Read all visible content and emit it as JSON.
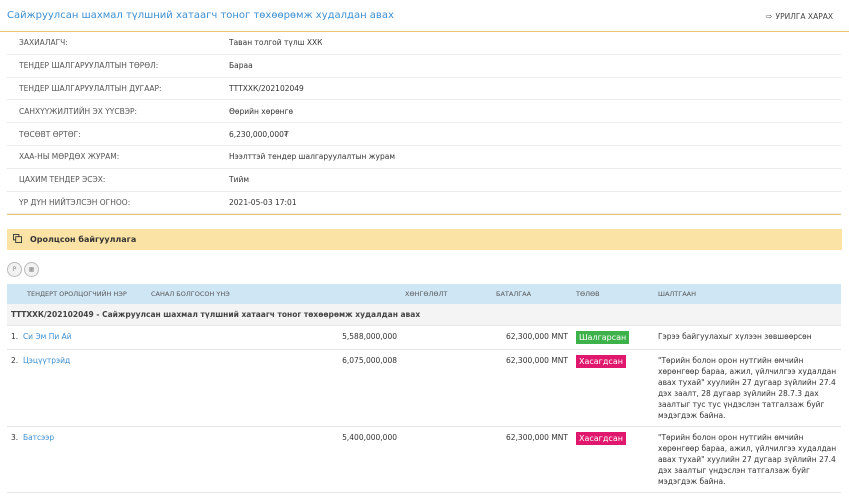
{
  "header": {
    "title": "Сайжруулсан шахмал түлшний хатаагч тоног төхөөрөмж худалдан авах",
    "back_label": "УРИЛГА ХАРАХ"
  },
  "info": [
    {
      "label": "ЗАХИАЛАГЧ:",
      "value": "Таван толгой түлш ХХК"
    },
    {
      "label": "ТЕНДЕР ШАЛГАРУУЛАЛТЫН ТӨРӨЛ:",
      "value": "Бараа"
    },
    {
      "label": "ТЕНДЕР ШАЛГАРУУЛАЛТЫН ДУГААР:",
      "value": "ТТТХХК/202102049"
    },
    {
      "label": "САНХҮҮЖИЛТИЙН ЭХ ҮҮСВЭР:",
      "value": "Өөрийн хөрөнгө"
    },
    {
      "label": "ТӨСӨВТ ӨРТӨГ:",
      "value": "6,230,000,000₮"
    },
    {
      "label": "ХАА-НЫ МӨРДӨХ ЖУРАМ:",
      "value": "Нээлттэй тендер шалгаруулалтын журам"
    },
    {
      "label": "ЦАХИМ ТЕНДЕР ЭСЭХ:",
      "value": "Тийм"
    },
    {
      "label": "ҮР ДҮН НИЙТЭЛСЭН ОГНОО:",
      "value": "2021-05-03 17:01"
    }
  ],
  "section": {
    "title": "Оролцсон байгууллага"
  },
  "toolbar": {
    "btn1": "P",
    "btn2": "▦"
  },
  "table": {
    "headers": [
      "ТЕНДЕРТ ОРОЛЦОГЧИЙН НЭР",
      "САНАЛ БОЛГОСОН ҮНЭ",
      "ХӨНГӨЛӨЛТ",
      "БАТАЛГАА",
      "ТӨЛӨВ",
      "ШАЛТГААН"
    ],
    "group": "ТТТХХК/202102049 - Сайжруулсан шахмал түлшний хатаагч тоног төхөөрөмж худалдан авах",
    "rows": [
      {
        "num": "1.",
        "name": "Си Эм Пи Ай",
        "price": "5,588,000,000",
        "discount": "",
        "guarantee": "62,300,000 MNT",
        "status": "Шалгарсан",
        "reason": "Гэрээ байгуулахыг хүлээн зөвшөөрсөн"
      },
      {
        "num": "2.",
        "name": "Цэцүүтрэйд",
        "price": "6,075,000,008",
        "discount": "",
        "guarantee": "62,300,000 MNT",
        "status": "Хасагдсан",
        "reason": "\"Төрийн болон орон нутгийн өмчийн хөрөнгөөр бараа, ажил, үйлчилгээ худалдан авах тухай\" хуулийн 27 дугаар зүйлийн 27.4 дэх заалт, 28 дугаар зүйлийн 28.7.3 дах заалтыг тус тус үндэслэн татгалзаж буйг мэдэгдэж байна."
      },
      {
        "num": "3.",
        "name": "Батсээр",
        "price": "5,400,000,000",
        "discount": "",
        "guarantee": "62,300,000 MNT",
        "status": "Хасагдсан",
        "reason": "\"Төрийн болон орон нутгийн өмчийн хөрөнгөөр бараа, ажил, үйлчилгээ худалдан авах тухай\" хуулийн 27 дугаар зүйлийн 27.4 дэх заалтыг үндэслэн татгалзаж буйг мэдэгдэж байна."
      }
    ]
  },
  "colors": {
    "accent": "#3d8fd1",
    "win": "#3eb24a",
    "lose": "#e0186d",
    "section_bg": "#fbe3a6",
    "table_head": "#cfe6f5"
  },
  "icons": {
    "back": "sign-out-icon",
    "section": "copy-icon"
  }
}
